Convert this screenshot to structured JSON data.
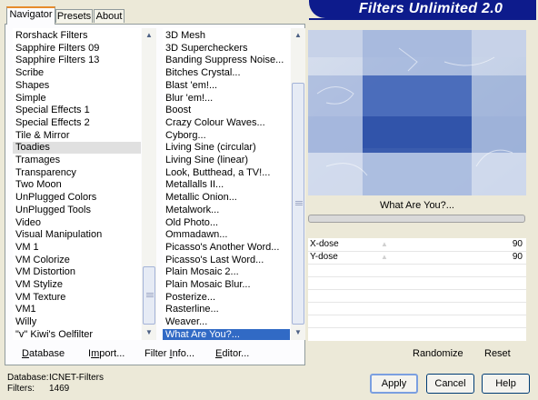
{
  "tabs": [
    "Navigator",
    "Presets",
    "About"
  ],
  "title": "Filters Unlimited 2.0",
  "categories": [
    "Rorshack Filters",
    "Sapphire Filters 09",
    "Sapphire Filters 13",
    "Scribe",
    "Shapes",
    "Simple",
    "Special Effects 1",
    "Special Effects 2",
    "Tile & Mirror",
    "Toadies",
    "Tramages",
    "Transparency",
    "Two Moon",
    "UnPlugged Colors",
    "UnPlugged Tools",
    "Video",
    "Visual Manipulation",
    "VM 1",
    "VM Colorize",
    "VM Distortion",
    "VM Stylize",
    "VM Texture",
    "VM1",
    "Willy",
    "\"v\" Kiwi's Oelfilter"
  ],
  "filters": [
    "3D Mesh",
    "3D Supercheckers",
    "Banding Suppress Noise...",
    "Bitches Crystal...",
    "Blast 'em!...",
    "Blur 'em!...",
    "Boost",
    "Crazy Colour Waves...",
    "Cyborg...",
    "Living Sine (circular)",
    "Living Sine (linear)",
    "Look, Butthead, a TV!...",
    "Metallalls II...",
    "Metallic Onion...",
    "Metalwork...",
    "Old Photo...",
    "Ommadawn...",
    "Picasso's Another Word...",
    "Picasso's Last Word...",
    "Plain Mosaic 2...",
    "Plain Mosaic Blur...",
    "Posterize...",
    "Rasterline...",
    "Weaver...",
    "What Are You?..."
  ],
  "selected_category": "Toadies",
  "selected_filter": "What Are You?...",
  "left_buttons": {
    "database": "Database",
    "import": "Import...",
    "filter_info": "Filter Info...",
    "editor": "Editor..."
  },
  "preview_label": "What Are You?...",
  "params": [
    {
      "label": "X-dose",
      "value": "90"
    },
    {
      "label": "Y-dose",
      "value": "90"
    }
  ],
  "right_buttons": {
    "randomize": "Randomize",
    "reset": "Reset"
  },
  "status": {
    "database_label": "Database:",
    "database_value": "ICNET-Filters",
    "filters_label": "Filters:",
    "filters_value": "1469"
  },
  "dialog_buttons": {
    "apply": "Apply",
    "cancel": "Cancel",
    "help": "Help"
  },
  "colors": {
    "banner": "#0d1b8c",
    "selection": "#316ac5"
  }
}
